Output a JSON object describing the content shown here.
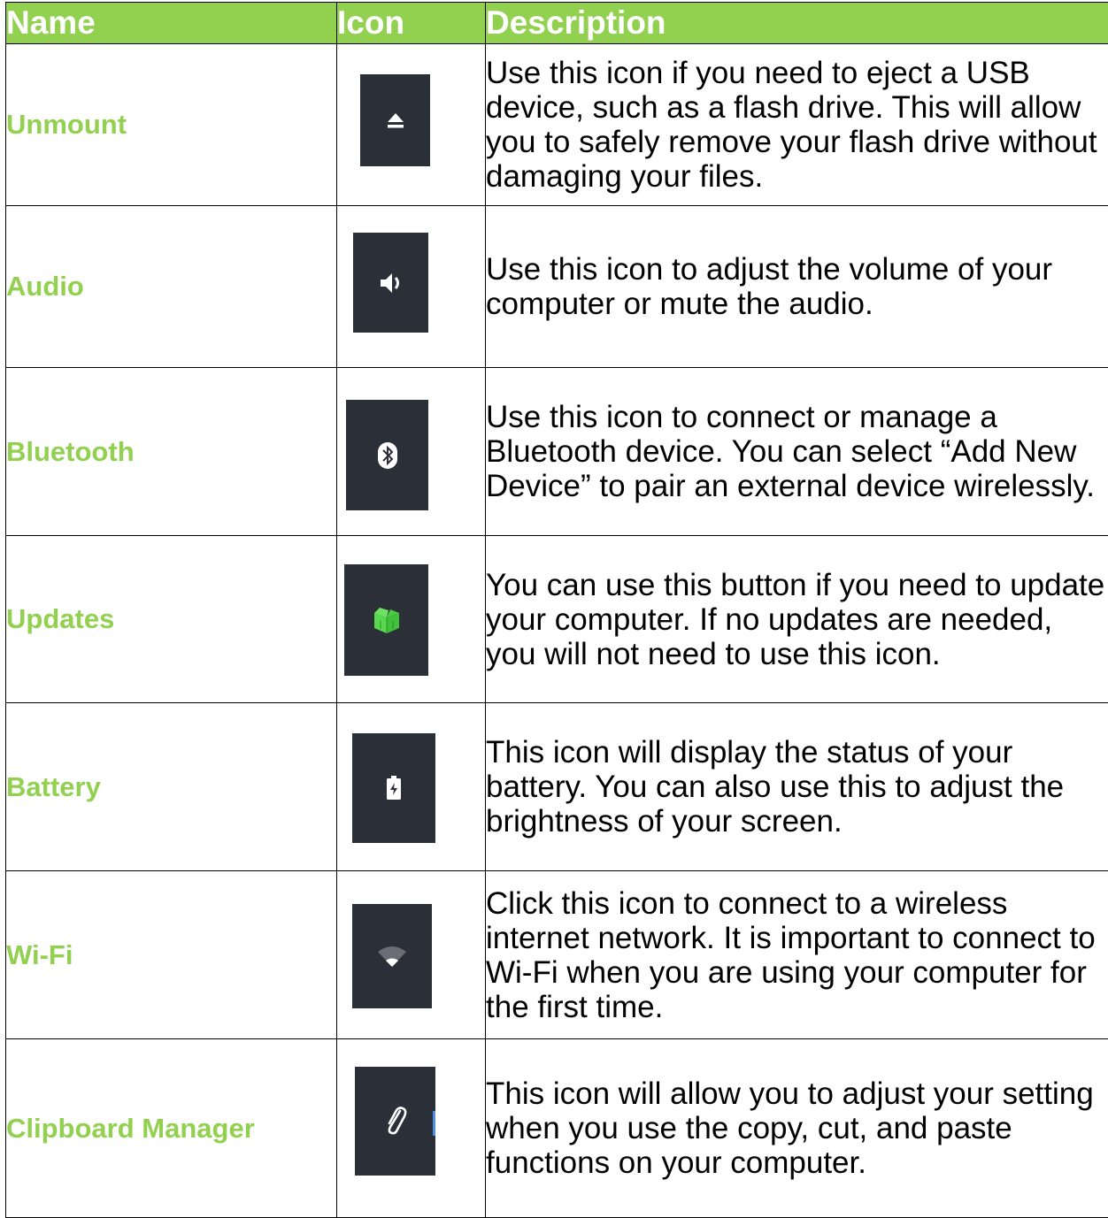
{
  "header": {
    "name": "Name",
    "icon": "Icon",
    "description": "Description"
  },
  "colors": {
    "accent": "#92d050",
    "icon_bg": "#2b2f37"
  },
  "rows": [
    {
      "name": "Unmount",
      "icon": "eject-icon",
      "description": "Use this icon if you need to eject a USB device, such as a flash drive. This will allow you to safely remove your flash drive without damaging your files."
    },
    {
      "name": "Audio",
      "icon": "speaker-icon",
      "description": "Use this icon to adjust the volume of your computer or mute the audio."
    },
    {
      "name": "Bluetooth",
      "icon": "bluetooth-icon",
      "description": "Use this icon to connect or manage a Bluetooth device. You can select “Add New Device” to pair an external device wirelessly."
    },
    {
      "name": "Updates",
      "icon": "updates-box-icon",
      "description": "You can use this button if you need to update your computer. If no updates are needed, you will not need to use this icon."
    },
    {
      "name": "Battery",
      "icon": "battery-icon",
      "description": "This icon will display the status of your battery. You can also use this to adjust the brightness of your screen."
    },
    {
      "name": "Wi-Fi",
      "icon": "wifi-icon",
      "description": "Click this icon to connect to a wireless internet network.  It is important to connect to Wi-Fi when you are using your computer for the first time."
    },
    {
      "name": "Clipboard Manager",
      "icon": "paperclip-icon",
      "description": "This icon will allow you to adjust your setting when you use the copy, cut, and paste functions on your computer."
    }
  ]
}
